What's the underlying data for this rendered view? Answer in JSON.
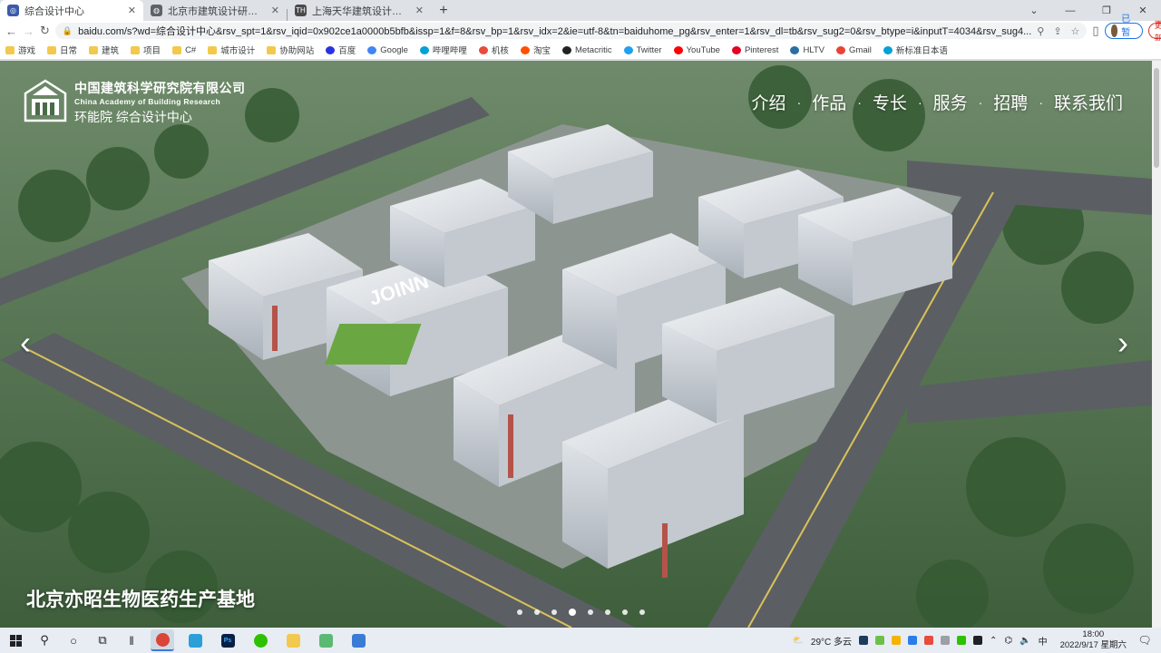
{
  "tabs": [
    {
      "title": "综合设计中心",
      "active": true,
      "favicon_color": "#3b5ba9",
      "favicon_text": "◎"
    },
    {
      "title": "北京市建筑设计研究院有限公司",
      "active": false,
      "favicon_color": "#5f6368",
      "favicon_text": "◍"
    },
    {
      "title": "上海天华建筑设计有限公司官网",
      "active": false,
      "favicon_color": "#4a4a4a",
      "favicon_text": "TH"
    }
  ],
  "toolbar": {
    "url": "baidu.com/s?wd=综合设计中心&rsv_spt=1&rsv_iqid=0x902ce1a0000b5bfb&issp=1&f=8&rsv_bp=1&rsv_idx=2&ie=utf-8&tn=baiduhome_pg&rsv_enter=1&rsv_dl=tb&rsv_sug2=0&rsv_btype=i&inputT=4034&rsv_sug4...",
    "profile_label": "已暂停",
    "update_label": "更新"
  },
  "bookmarks": [
    {
      "label": "游戏",
      "type": "folder"
    },
    {
      "label": "日常",
      "type": "folder"
    },
    {
      "label": "建筑",
      "type": "folder"
    },
    {
      "label": "项目",
      "type": "folder"
    },
    {
      "label": "C#",
      "type": "folder"
    },
    {
      "label": "城市设计",
      "type": "folder"
    },
    {
      "label": "协助网站",
      "type": "folder"
    },
    {
      "label": "百度",
      "type": "baidu"
    },
    {
      "label": "Google",
      "type": "google"
    },
    {
      "label": "哔哩哔哩",
      "type": "bilibili"
    },
    {
      "label": "机核",
      "type": "gcores"
    },
    {
      "label": "淘宝",
      "type": "taobao"
    },
    {
      "label": "Metacritic",
      "type": "metacritic"
    },
    {
      "label": "Twitter",
      "type": "twitter"
    },
    {
      "label": "YouTube",
      "type": "youtube"
    },
    {
      "label": "Pinterest",
      "type": "pinterest"
    },
    {
      "label": "HLTV",
      "type": "hltv"
    },
    {
      "label": "Gmail",
      "type": "gmail"
    },
    {
      "label": "新标准日本语",
      "type": "bilibili"
    }
  ],
  "site": {
    "logo_cn": "中国建筑科学研究院有限公司",
    "logo_en": "China Academy of Building Research",
    "logo_sub": "环能院 综合设计中心",
    "nav": [
      "介绍",
      "作品",
      "专长",
      "服务",
      "招聘",
      "联系我们"
    ],
    "nav_separator": "·",
    "prev_arrow": "‹",
    "next_arrow": "›",
    "caption": "北京亦昭生物医药生产基地",
    "slide_count": 8,
    "active_slide_index": 3
  },
  "taskbar": {
    "weather": "29°C 多云",
    "time": "18:00",
    "date": "2022/9/17 星期六",
    "ime_label": "中"
  },
  "colors": {
    "accent_blue": "#1a73e8",
    "update_red": "#d93025",
    "tabstrip_bg": "#dee1e6"
  }
}
